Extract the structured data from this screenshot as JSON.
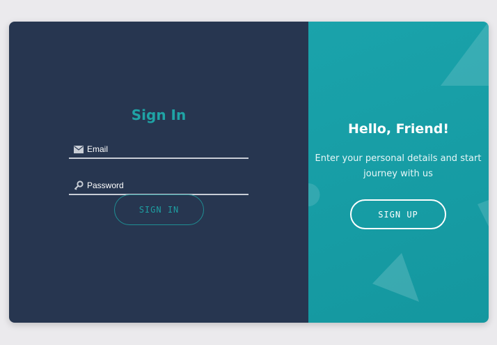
{
  "sign_in": {
    "title": "Sign In",
    "email_placeholder": "Email",
    "password_placeholder": "Password",
    "button_label": "SIGN IN"
  },
  "overlay": {
    "title": "Hello, Friend!",
    "text": "Enter your personal details and start journey with us",
    "button_label": "SIGN UP"
  },
  "colors": {
    "page_bg": "#ebeaed",
    "left_panel_bg": "#273650",
    "right_panel_bg": "#1aa3ab",
    "accent": "#1fa3a5"
  },
  "icons": {
    "email": "envelope-icon",
    "password": "key-icon"
  }
}
